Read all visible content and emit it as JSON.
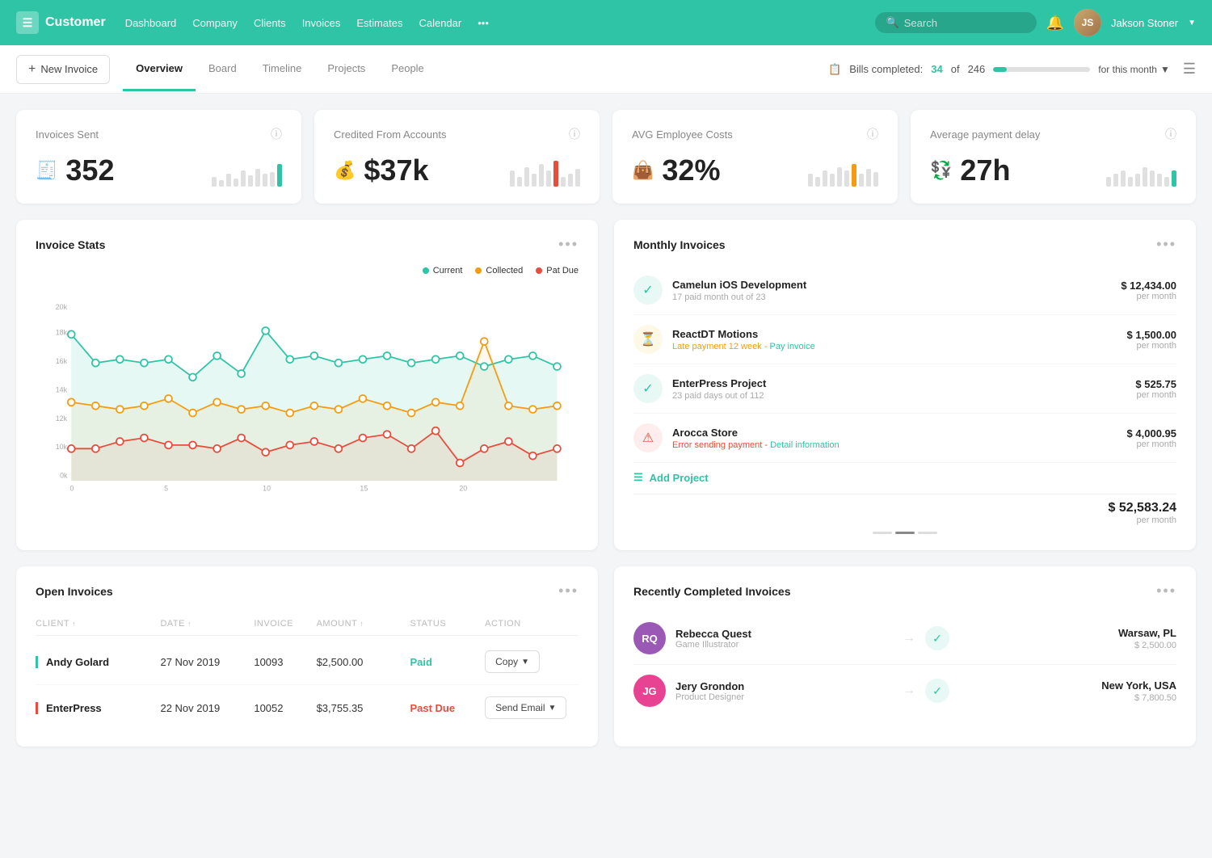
{
  "brand": {
    "icon": "☰",
    "name": "Customer"
  },
  "topnav": {
    "links": [
      "Dashboard",
      "Company",
      "Clients",
      "Invoices",
      "Estimates",
      "Calendar",
      "•••"
    ],
    "search_placeholder": "Search",
    "bell": "🔔",
    "user_name": "Jakson Stoner"
  },
  "secondnav": {
    "new_invoice": "New Invoice",
    "tabs": [
      "Overview",
      "Board",
      "Timeline",
      "Projects",
      "People"
    ],
    "active_tab": "Overview",
    "bills_label": "Bills completed:",
    "bills_done": "34",
    "bills_total": "246",
    "bills_period": "for this month"
  },
  "stat_cards": [
    {
      "title": "Invoices Sent",
      "icon": "🧾",
      "value": "352",
      "bars": [
        3,
        2,
        4,
        2,
        5,
        3,
        6,
        4,
        5,
        7
      ],
      "highlight_index": 9,
      "highlight_color": "green"
    },
    {
      "title": "Credited From Accounts",
      "icon": "💰",
      "value": "$37k",
      "bars": [
        5,
        3,
        6,
        4,
        7,
        5,
        8,
        3,
        4,
        6
      ],
      "highlight_index": 6,
      "highlight_color": "red"
    },
    {
      "title": "AVG Employee Costs",
      "icon": "👜",
      "value": "32%",
      "bars": [
        4,
        3,
        5,
        4,
        6,
        5,
        7,
        4,
        6,
        5
      ],
      "highlight_index": 6,
      "highlight_color": "orange"
    },
    {
      "title": "Average payment delay",
      "icon": "💱",
      "value": "27h",
      "bars": [
        3,
        4,
        5,
        3,
        4,
        6,
        5,
        4,
        3,
        5
      ],
      "highlight_index": 9,
      "highlight_color": "blue"
    }
  ],
  "invoice_stats": {
    "title": "Invoice Stats",
    "legend": {
      "current": "Current",
      "collected": "Collected",
      "past_due": "Pat Due"
    }
  },
  "monthly_invoices": {
    "title": "Monthly Invoices",
    "items": [
      {
        "name": "Camelun iOS Development",
        "sub": "17 paid month out of 23",
        "sub_color": "normal",
        "icon_type": "green",
        "icon": "✓",
        "price": "$ 12,434.00",
        "period": "per month"
      },
      {
        "name": "ReactDT Motions",
        "sub": "Late payment 12 week",
        "sub_extra": "Pay invoice",
        "sub_color": "orange",
        "icon_type": "orange",
        "icon": "⏳",
        "price": "$ 1,500.00",
        "period": "per month"
      },
      {
        "name": "EnterPress Project",
        "sub": "23 paid days out of 112",
        "sub_color": "normal",
        "icon_type": "green",
        "icon": "✓",
        "price": "$ 525.75",
        "period": "per month"
      },
      {
        "name": "Arocca Store",
        "sub": "Error sending payment",
        "sub_extra": "Detail information",
        "sub_color": "red",
        "icon_type": "red",
        "icon": "⚠",
        "price": "$ 4,000.95",
        "period": "per month"
      }
    ],
    "add_project": "Add Project",
    "total_price": "$ 52,583.24",
    "total_period": "per month"
  },
  "open_invoices": {
    "title": "Open Invoices",
    "columns": [
      "CLIENT",
      "DATE",
      "INVOICE",
      "AMOUNT",
      "STATUS",
      "ACTION"
    ],
    "rows": [
      {
        "client": "Andy Golard",
        "date": "27 Nov 2019",
        "invoice": "10093",
        "amount": "$2,500.00",
        "status": "Paid",
        "status_color": "paid",
        "action": "Copy",
        "border_color": "green"
      },
      {
        "client": "EnterPress",
        "date": "22 Nov 2019",
        "invoice": "10052",
        "amount": "$3,755.35",
        "status": "Past Due",
        "status_color": "past-due",
        "action": "Send Email",
        "border_color": "red"
      }
    ]
  },
  "recently_completed": {
    "title": "Recently Completed Invoices",
    "items": [
      {
        "initials": "RQ",
        "color": "purple",
        "name": "Rebecca Quest",
        "role": "Game Illustrator",
        "location": "Warsaw, PL",
        "amount": "$ 2,500.00"
      },
      {
        "initials": "JG",
        "color": "pink",
        "name": "Jery Grondon",
        "role": "Product Designer",
        "location": "New York, USA",
        "amount": "$ 7,800.50"
      }
    ]
  }
}
